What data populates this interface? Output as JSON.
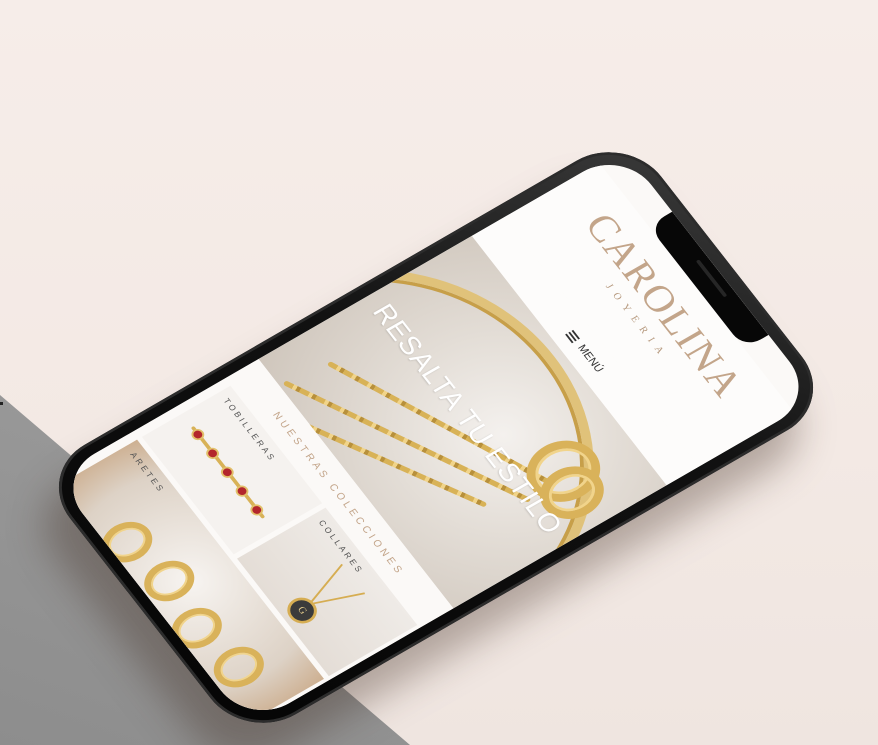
{
  "brand": {
    "name": "CAROLINA",
    "subtitle": "JOYERIA"
  },
  "nav": {
    "menu_label": "MENÚ"
  },
  "hero": {
    "title": "RESALTA TU ESTILO"
  },
  "collections": {
    "title": "NUESTRAS COLECCIONES",
    "items": [
      {
        "label": "TOBILLERAS"
      },
      {
        "label": "COLLARES",
        "pendant_letter": "G"
      },
      {
        "label": "ARETES"
      }
    ]
  },
  "colors": {
    "brand_gold": "#c3a58a",
    "jewelry_gold": "#d9b25a",
    "background": "#f3e9e4",
    "phone_frame": "#111111"
  },
  "icons": [
    "hamburger-menu-icon"
  ]
}
